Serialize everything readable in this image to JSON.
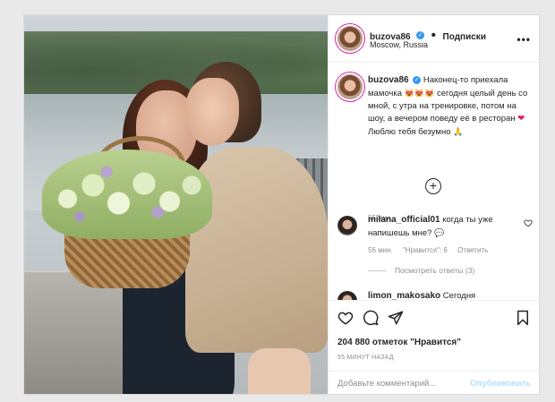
{
  "post": {
    "username": "buzova86",
    "verified_badge": "✓",
    "follow_label": "Подписки",
    "separator": "•",
    "location": "Moscow, Russia",
    "more_label": "•••"
  },
  "caption": {
    "username": "buzova86",
    "text_1": "Наконец-то приехала мамочка",
    "emojis_1": "😻😻😻",
    "text_2": "сегодня целый день со мной, с утра на тренировке, потом на шоу, а вечером поведу её в ресторан",
    "heart": "❤",
    "text_3": "Люблю тебя безумно",
    "emoji_pray": "🙏",
    "time_ago": "55 мин.",
    "load_more": "+"
  },
  "comment": {
    "username": "milana_official01",
    "text": "когда ты уже напишешь мне?",
    "emoji": "💬",
    "time": "56 мин.",
    "likes": "\"Нравится\": 6",
    "reply_label": "Ответить",
    "view_replies": "Посмотреть ответы (3)",
    "next_username": "limon_makosako",
    "next_text": "Сегодня"
  },
  "actions": {
    "like_icon": "heart-outline-icon",
    "comment_icon": "comment-bubble-icon",
    "share_icon": "paper-plane-icon",
    "save_icon": "bookmark-icon",
    "likes_count": "204 880 отметок \"Нравится\"",
    "posted_ago": "55 МИНУТ НАЗАД"
  },
  "add_comment": {
    "placeholder": "Добавьте комментарий...",
    "publish_label": "Опубликовать"
  },
  "colors": {
    "verified": "#3897f0",
    "publish_disabled": "#b2dffc",
    "heart_red": "#e0245e"
  }
}
